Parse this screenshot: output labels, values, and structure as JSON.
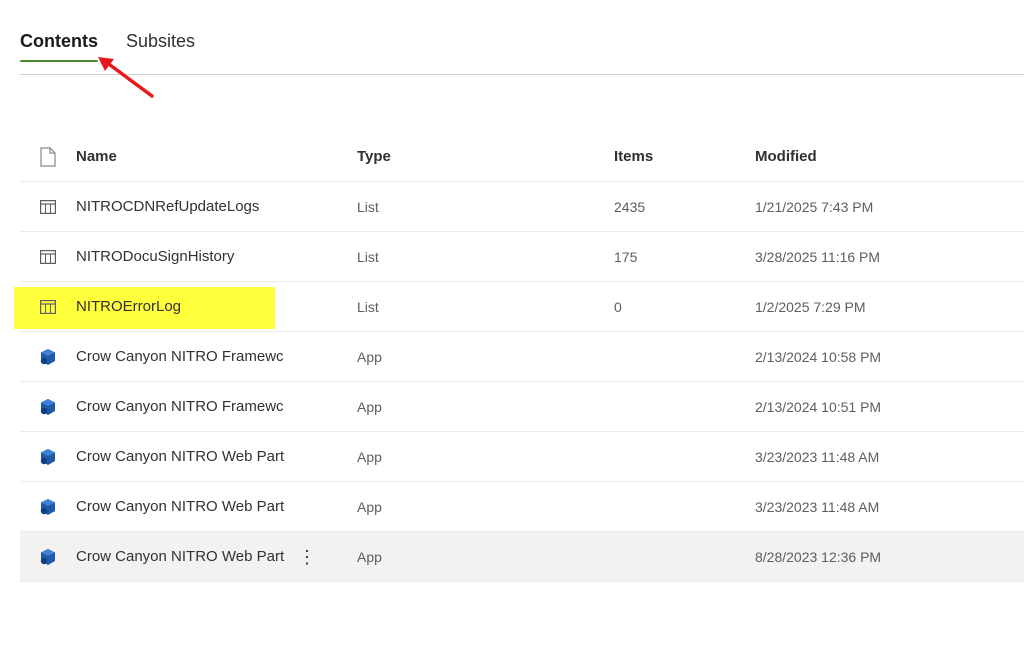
{
  "tabs": [
    {
      "label": "Contents",
      "active": true
    },
    {
      "label": "Subsites",
      "active": false
    }
  ],
  "table": {
    "columns": {
      "name": "Name",
      "type": "Type",
      "items": "Items",
      "modified": "Modified"
    },
    "rows": [
      {
        "icon": "list-icon",
        "name": "NITROCDNRefUpdateLogs",
        "type": "List",
        "items": "2435",
        "modified": "1/21/2025 7:43 PM"
      },
      {
        "icon": "list-icon",
        "name": "NITRODocuSignHistory",
        "type": "List",
        "items": "175",
        "modified": "3/28/2025 11:16 PM"
      },
      {
        "icon": "list-icon",
        "name": "NITROErrorLog",
        "type": "List",
        "items": "0",
        "modified": "1/2/2025 7:29 PM",
        "highlighted": true
      },
      {
        "icon": "app-icon",
        "name": "Crow Canyon NITRO Framewc",
        "type": "App",
        "items": "",
        "modified": "2/13/2024 10:58 PM"
      },
      {
        "icon": "app-icon",
        "name": "Crow Canyon NITRO Framewc",
        "type": "App",
        "items": "",
        "modified": "2/13/2024 10:51 PM"
      },
      {
        "icon": "app-icon",
        "name": "Crow Canyon NITRO Web Part",
        "type": "App",
        "items": "",
        "modified": "3/23/2023 11:48 AM"
      },
      {
        "icon": "app-icon",
        "name": "Crow Canyon NITRO Web Part",
        "type": "App",
        "items": "",
        "modified": "3/23/2023 11:48 AM"
      },
      {
        "icon": "app-icon",
        "name": "Crow Canyon NITRO Web Part",
        "type": "App",
        "items": "",
        "modified": "8/28/2023 12:36 PM",
        "selected": true
      }
    ]
  },
  "colors": {
    "tab_underline": "#4a8a2a",
    "highlight": "#ffff3c",
    "annotation_arrow": "#e8191c",
    "app_icon": "#1f5aa8"
  }
}
